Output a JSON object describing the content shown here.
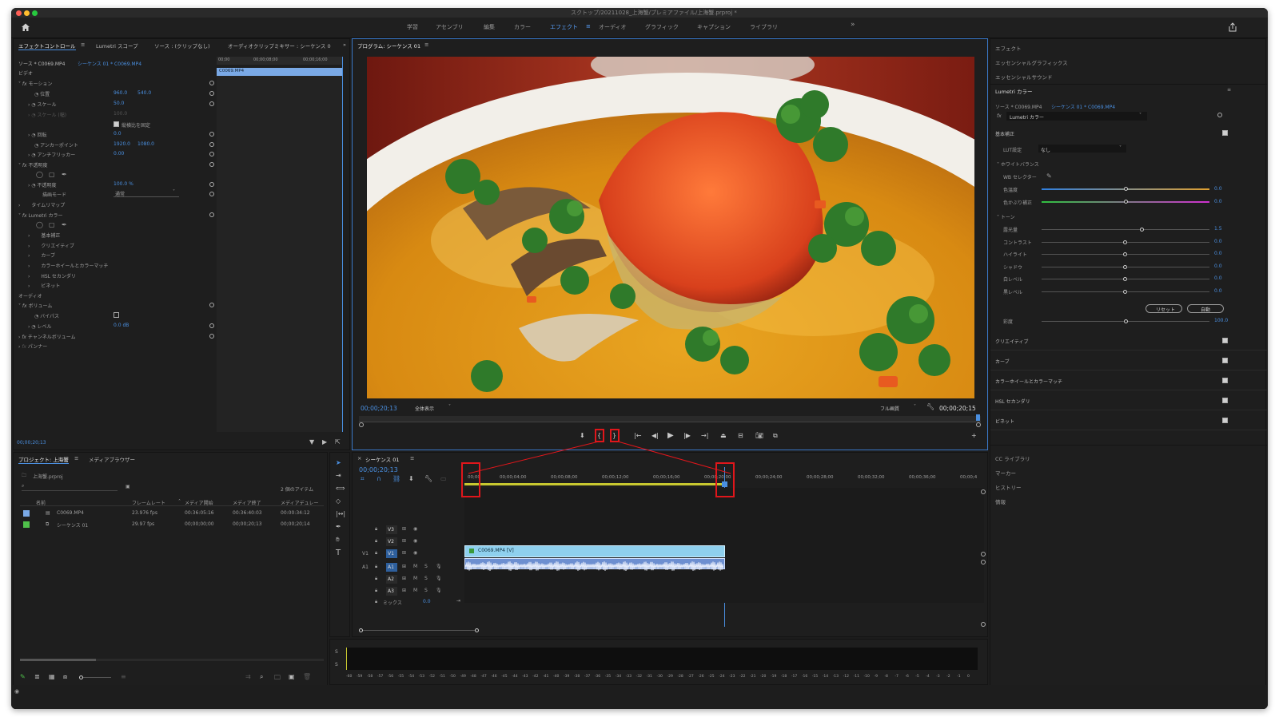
{
  "window": {
    "title": "スクトップ/20211028_上海蟹/プレミアファイル/上海蟹.prproj *"
  },
  "workspaces": [
    "学習",
    "アセンブリ",
    "編集",
    "カラー",
    "エフェクト",
    "オーディオ",
    "グラフィック",
    "キャプション",
    "ライブラリ"
  ],
  "active_workspace": "エフェクト",
  "colors": {
    "accent": "#4a8fe0",
    "red": "#e0161b",
    "clip_video": "#8fd0ee",
    "clip_audio": "#6d8fd0",
    "bg": "#1d1d1d"
  },
  "effect_controls": {
    "tabs": [
      "エフェクトコントロール",
      "Lumetri スコープ",
      "ソース : (クリップなし)",
      "オーディオクリップミキサー : シーケンス 0"
    ],
    "source": "ソース * C0069.MP4",
    "sequence": "シーケンス 01 * C0069.MP4",
    "ruler": [
      "00;00",
      "00;00;08;00",
      "00;00;16;00"
    ],
    "clip": "C0069.MP4",
    "video_label": "ビデオ",
    "motion": "モーション",
    "position": "位置",
    "pos_x": "960.0",
    "pos_y": "540.0",
    "scale": "スケール",
    "scale_val": "50.0",
    "scale_w": "スケール (幅)",
    "scale_w_val": "100.0",
    "keep_ratio": "縦横比を固定",
    "rotation": "回転",
    "rotation_val": "0.0",
    "anchor": "アンカーポイント",
    "anchor_x": "1920.0",
    "anchor_y": "1080.0",
    "flicker": "アンチフリッカー",
    "flicker_val": "0.00",
    "opacity_group": "不透明度",
    "opacity": "不透明度",
    "opacity_val": "100.0 %",
    "blend": "描画モード",
    "blend_val": "通常",
    "time_remap": "タイムリマップ",
    "lumetri": "Lumetri カラー",
    "lumetri_items": [
      "基本補正",
      "クリエイティブ",
      "カーブ",
      "カラーホイールとカラーマッチ",
      "HSL セカンダリ",
      "ビネット"
    ],
    "audio_label": "オーディオ",
    "volume": "ボリューム",
    "bypass": "バイパス",
    "level": "レベル",
    "level_val": "0.0 dB",
    "channel_volume": "チャンネルボリューム",
    "panner": "パンナー",
    "timecode": "00;00;20;13"
  },
  "program": {
    "title": "プログラム: シーケンス 01",
    "timecode": "00;00;20;13",
    "fit": "全体表示",
    "quality": "フル画質",
    "duration": "00;00;20;15"
  },
  "project": {
    "tabs": [
      "プロジェクト: 上海蟹",
      "メディアブラウザー"
    ],
    "file": "上海蟹.prproj",
    "items_count": "2 個のアイテム",
    "columns": [
      "名前",
      "フレームレート",
      "メディア開始",
      "メディア終了",
      "メディアデュレー"
    ],
    "rows": [
      {
        "name": "C0069.MP4",
        "fps": "23.976 fps",
        "start": "00:36:05:16",
        "end": "00:36:40:03",
        "dur": "00:00:34:12",
        "color": "#7aa9e6"
      },
      {
        "name": "シーケンス 01",
        "fps": "29.97 fps",
        "start": "00;00;00;00",
        "end": "00;00;20;13",
        "dur": "00;00;20;14",
        "color": "#4fc04a"
      }
    ]
  },
  "timeline": {
    "title": "シーケンス 01",
    "timecode": "00;00;20;13",
    "ruler": [
      "00;00",
      "00;00;04;00",
      "00;00;08;00",
      "00;00;12;00",
      "00;00;16;00",
      "00;00;20;00",
      "00;00;24;00",
      "00;00;28;00",
      "00;00;32;00",
      "00;00;36;00",
      "00;00;4"
    ],
    "tracks": [
      "V3",
      "V2",
      "V1",
      "A1",
      "A2",
      "A3"
    ],
    "mix": "ミックス",
    "mix_val": "0.0",
    "clip_label": "C0069.MP4 [V]"
  },
  "meter": {
    "scale": [
      "-60",
      "-59",
      "-58",
      "-57",
      "-56",
      "-55",
      "-54",
      "-53",
      "-52",
      "-51",
      "-50",
      "-49",
      "-48",
      "-47",
      "-46",
      "-45",
      "-44",
      "-43",
      "-42",
      "-41",
      "-40",
      "-39",
      "-38",
      "-37",
      "-36",
      "-35",
      "-34",
      "-33",
      "-32",
      "-31",
      "-30",
      "-29",
      "-28",
      "-27",
      "-26",
      "-25",
      "-24",
      "-23",
      "-22",
      "-21",
      "-20",
      "-19",
      "-18",
      "-17",
      "-16",
      "-15",
      "-14",
      "-13",
      "-12",
      "-11",
      "-10",
      "-9",
      "-8",
      "-7",
      "-6",
      "-5",
      "-4",
      "-3",
      "-2",
      "-1",
      "0"
    ],
    "s": "S"
  },
  "right": {
    "top_panels": [
      "エフェクト",
      "エッセンシャルグラフィックス",
      "エッセンシャルサウンド"
    ],
    "lumetri_title": "Lumetri カラー",
    "source": "ソース * C0069.MP4",
    "sequence": "シーケンス 01 * C0069.MP4",
    "effect_select": "Lumetri カラー",
    "basic": "基本補正",
    "lut_label": "LUT設定",
    "lut_val": "なし",
    "wb": "ホワイトバランス",
    "wb_selector": "WB セレクター",
    "temp": "色温度",
    "temp_val": "0.0",
    "tint": "色かぶり補正",
    "tint_val": "0.0",
    "tone": "トーン",
    "tone_sliders": [
      {
        "label": "露光量",
        "val": "1.5",
        "pos": 0.6
      },
      {
        "label": "コントラスト",
        "val": "0.0",
        "pos": 0.5
      },
      {
        "label": "ハイライト",
        "val": "0.0",
        "pos": 0.5
      },
      {
        "label": "シャドウ",
        "val": "0.0",
        "pos": 0.5
      },
      {
        "label": "白レベル",
        "val": "0.0",
        "pos": 0.5
      },
      {
        "label": "黒レベル",
        "val": "0.0",
        "pos": 0.5
      }
    ],
    "reset": "リセット",
    "auto": "自動",
    "saturation": "彩度",
    "saturation_val": "100.0",
    "sections": [
      "クリエイティブ",
      "カーブ",
      "カラーホイールとカラーマッチ",
      "HSL セカンダリ",
      "ビネット"
    ],
    "bottom_panels": [
      "CC ライブラリ",
      "マーカー",
      "ヒストリー",
      "情報"
    ]
  }
}
